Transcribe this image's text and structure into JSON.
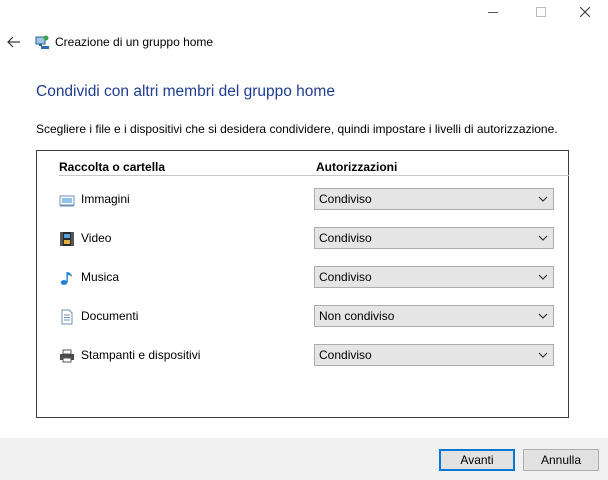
{
  "window": {
    "title": "Creazione di un gruppo home",
    "controls": [
      "minimize-icon",
      "maximize-icon",
      "close-icon"
    ]
  },
  "page": {
    "heading": "Condividi con altri membri del gruppo home",
    "instructions": "Scegliere i file e i dispositivi che si desidera condividere, quindi impostare i livelli di autorizzazione."
  },
  "table": {
    "headers": {
      "folder": "Raccolta o cartella",
      "permissions": "Autorizzazioni"
    },
    "rows": [
      {
        "label": "Immagini",
        "icon": "pictures-library-icon",
        "permission": "Condiviso"
      },
      {
        "label": "Video",
        "icon": "videos-library-icon",
        "permission": "Condiviso"
      },
      {
        "label": "Musica",
        "icon": "music-library-icon",
        "permission": "Condiviso"
      },
      {
        "label": "Documenti",
        "icon": "documents-library-icon",
        "permission": "Non condiviso"
      },
      {
        "label": "Stampanti e dispositivi",
        "icon": "printer-icon",
        "permission": "Condiviso"
      }
    ]
  },
  "footer": {
    "next_label": "Avanti",
    "cancel_label": "Annulla"
  },
  "colors": {
    "heading": "#1e3d8f",
    "primary_border": "#0078d7",
    "footer_bg": "#f0f0f0"
  }
}
